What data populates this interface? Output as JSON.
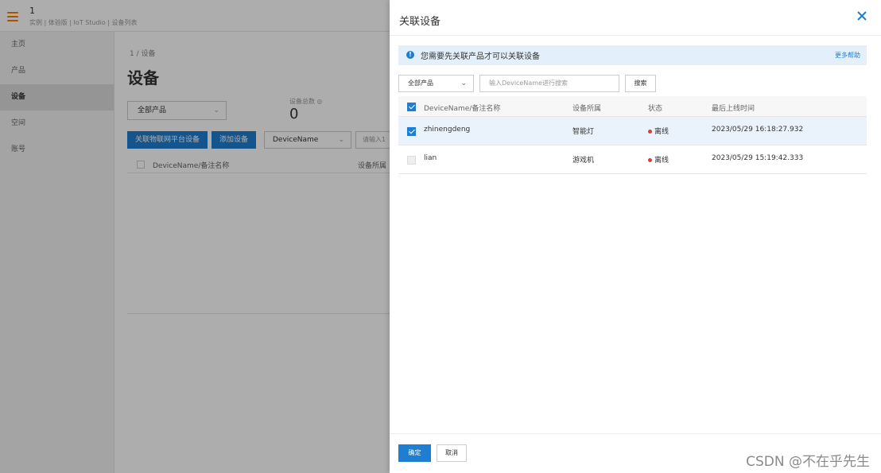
{
  "app": {
    "name": "1",
    "breadcrumb": "实例 | 体验版 | IoT Studio | 设备列表"
  },
  "sidebar": {
    "items": [
      {
        "label": "主页"
      },
      {
        "label": "产品"
      },
      {
        "label": "设备"
      },
      {
        "label": "空间"
      },
      {
        "label": "账号"
      }
    ]
  },
  "main": {
    "crumb": "1 / 设备",
    "title": "设备",
    "product_select": "全部产品",
    "device_count_label": "设备总数 ◎",
    "device_count": "0",
    "link_button": "关联物联网平台设备",
    "add_button": "添加设备",
    "filter_select": "DeviceName",
    "filter_placeholder": "请输入1",
    "table_headers": [
      "DeviceName/备注名称",
      "设备所属"
    ]
  },
  "drawer": {
    "title": "关联设备",
    "notice": "您需要先关联产品才可以关联设备",
    "more_help": "更多帮助",
    "product_select": "全部产品",
    "search_placeholder": "输入DeviceName进行搜索",
    "search_button": "搜索",
    "headers": {
      "name": "DeviceName/备注名称",
      "product": "设备所属",
      "status": "状态",
      "last_online": "最后上线时间"
    },
    "rows": [
      {
        "name": "zhinengdeng",
        "product": "智能灯",
        "status": "离线",
        "last_online": "2023/05/29 16:18:27.932",
        "checked": true
      },
      {
        "name": "lian",
        "product": "游戏机",
        "status": "离线",
        "last_online": "2023/05/29 15:19:42.333",
        "checked": false
      }
    ],
    "confirm_button": "确定",
    "cancel_button": "取消"
  },
  "watermark": "CSDN @不在乎先生",
  "colors": {
    "accent": "#1f7ed1",
    "offline": "#e53935",
    "menu_icon": "#f57c00",
    "notice_bg": "#e3f0fb"
  }
}
